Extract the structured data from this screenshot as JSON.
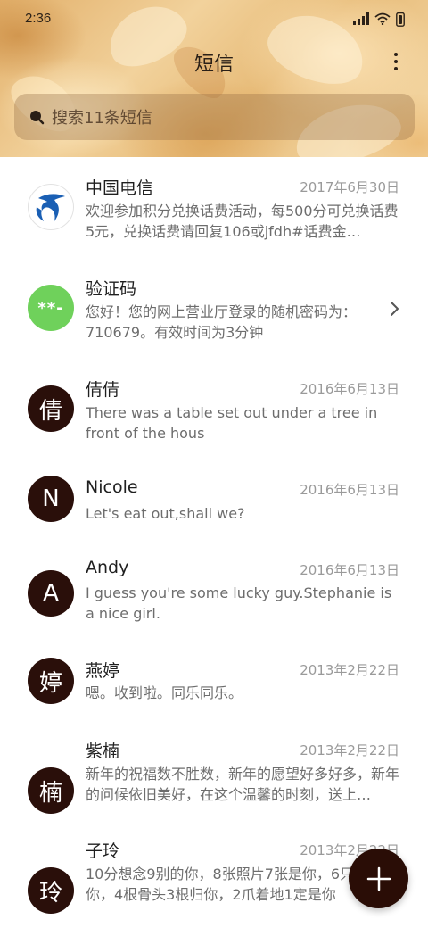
{
  "status_bar": {
    "time": "2:36"
  },
  "header": {
    "title": "短信"
  },
  "search": {
    "placeholder": "搜索11条短信"
  },
  "conversations": [
    {
      "name": "中国电信",
      "date": "2017年6月30日",
      "avatar": "telecom-logo",
      "snippet": "欢迎参加积分兑换话费活动，每500分可兑换话费5元，兑换话费请回复106或jfdh#话费金…"
    },
    {
      "name": "验证码",
      "avatar_text": "**-",
      "avatar_color": "#6fd15b",
      "snippet": "您好！您的网上营业厅登录的随机密码为：710679。有效时间为3分钟"
    },
    {
      "name": "倩倩",
      "date": "2016年6月13日",
      "avatar_text": "倩",
      "snippet": "There was a table set out under a tree in front of the hous"
    },
    {
      "name": "Nicole",
      "date": "2016年6月13日",
      "avatar_text": "N",
      "snippet": "Let's eat out,shall we?"
    },
    {
      "name": "Andy",
      "date": "2016年6月13日",
      "avatar_text": "A",
      "snippet": "I guess you're some lucky guy.Stephanie is a nice girl."
    },
    {
      "name": "燕婷",
      "date": "2013年2月22日",
      "avatar_text": "婷",
      "snippet": "嗯。收到啦。同乐同乐。"
    },
    {
      "name": "紫楠",
      "date": "2013年2月22日",
      "avatar_text": "楠",
      "snippet": "新年的祝福数不胜数，新年的愿望好多好多，新年的问候依旧美好，在这个温馨的时刻，送上…"
    },
    {
      "name": "子玲",
      "date": "2013年2月22日",
      "avatar_text": "玲",
      "snippet": "10分想念9别的你，8张照片7张是你，6只只像你，4根骨头3根归你，2爪着地1定是你"
    }
  ],
  "colors": {
    "avatar_dark": "#2a0f0a",
    "fab": "#2a0d06",
    "code_avatar": "#6fd15b"
  },
  "icons": [
    "signal-icon",
    "wifi-icon",
    "battery-icon",
    "more-icon",
    "search-icon",
    "chevron-right-icon",
    "plus-icon",
    "telecom-logo-icon"
  ]
}
